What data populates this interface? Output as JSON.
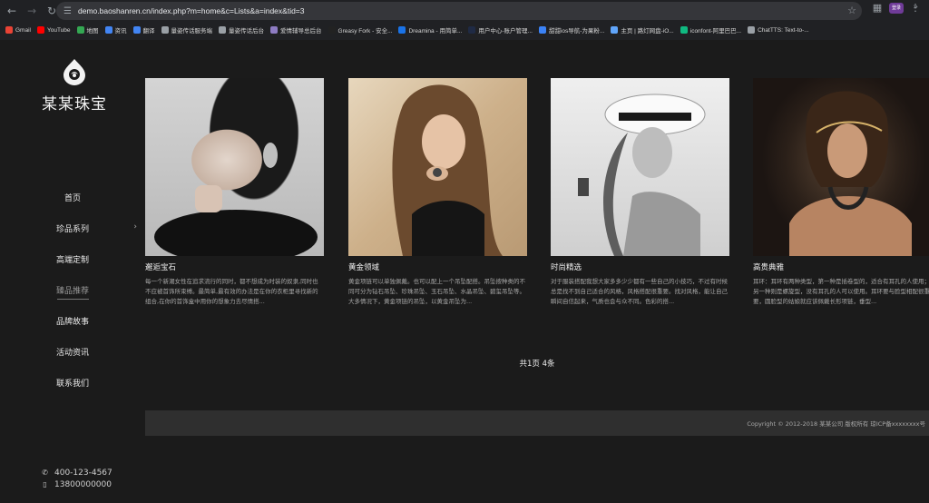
{
  "browser": {
    "url": "demo.baoshanren.cn/index.php?m=home&c=Lists&a=index&tid=3",
    "profile": "登录",
    "bookmarks": [
      {
        "label": "Gmail",
        "color": "#ea4335"
      },
      {
        "label": "YouTube",
        "color": "#ff0000"
      },
      {
        "label": "地图",
        "color": "#34a853"
      },
      {
        "label": "资讯",
        "color": "#4285f4"
      },
      {
        "label": "翻译",
        "color": "#4285f4"
      },
      {
        "label": "量姿传话服务端",
        "color": "#9aa0a6"
      },
      {
        "label": "量姿传话后台",
        "color": "#9aa0a6"
      },
      {
        "label": "爱情辅导总后台",
        "color": "#8e7cc3"
      },
      {
        "label": "Greasy Fork - 安全...",
        "color": "#222222"
      },
      {
        "label": "Dreamina - 用简单...",
        "color": "#1a73e8"
      },
      {
        "label": "用户中心-账户管理...",
        "color": "#1f2a44"
      },
      {
        "label": "甜甜ios导航-为果粉...",
        "color": "#3b82f6"
      },
      {
        "label": "主页 | 路灯网盘-iO...",
        "color": "#60a5fa"
      },
      {
        "label": "iconfont-阿里巴巴...",
        "color": "#10b981"
      },
      {
        "label": "ChatTTS: Text-to-...",
        "color": "#9aa0a6"
      }
    ]
  },
  "site": {
    "logo_text": "某某珠宝",
    "menu": [
      {
        "label": "首页",
        "active": false,
        "has_arrow": false
      },
      {
        "label": "珍品系列",
        "active": false,
        "has_arrow": true
      },
      {
        "label": "高端定制",
        "active": false,
        "has_arrow": false
      },
      {
        "label": "臻品推荐",
        "active": true,
        "has_arrow": false
      },
      {
        "label": "品牌故事",
        "active": false,
        "has_arrow": false
      },
      {
        "label": "活动资讯",
        "active": false,
        "has_arrow": false
      },
      {
        "label": "联系我们",
        "active": false,
        "has_arrow": false
      }
    ],
    "contact": {
      "tel": "400-123-4567",
      "mobile": "13800000000"
    }
  },
  "cards": [
    {
      "title": "邂逅宝石",
      "desc": "每一个新潮女性在追求流行的同时，都不想成为时装的奴隶,同时也不应被首饰所束缚。最简单,最有效的办法是在你的衣柜里寻找新的组合,在你的首饰盒中用你的想象力去尽情搭...",
      "bg": "#c9c9c9"
    },
    {
      "title": "黄金领域",
      "desc": "黄金项链可以单独佩戴。也可以配上一个吊坠配搭。吊坠按种类的不同可分为钻石吊坠、珍珠吊坠、玉石吊坠、水晶吊坠、碧玺吊坠等。大多情况下，黄金项链的吊坠，以黄金吊坠为...",
      "bg": "#c9ae8a"
    },
    {
      "title": "时尚精选",
      "desc": "对于服装搭配我想大家多多少少都有一些自己的小技巧，不过有时候总是找不到自己适合的风格，风格搭配很重要。找对风格，能让自己瞬间自信起来，气质也会与众不同。色彩的搭...",
      "bg": "#8a8a8a"
    },
    {
      "title": "高贵典雅",
      "desc": "耳环：耳环有两种类型，第一种是插卷型的，适合有耳孔的人使用；另一种则是螺旋型，没有耳孔的人可以使用。耳环要与脸型相配很重要，圆脸型的姑娘就应该佩戴长形项链，垂型...",
      "bg": "#5a4a3e"
    }
  ],
  "pager_text": "共1页 4条",
  "copyright": "Copyright © 2012-2018 某某公司 版权所有 琼ICP备xxxxxxxx号"
}
